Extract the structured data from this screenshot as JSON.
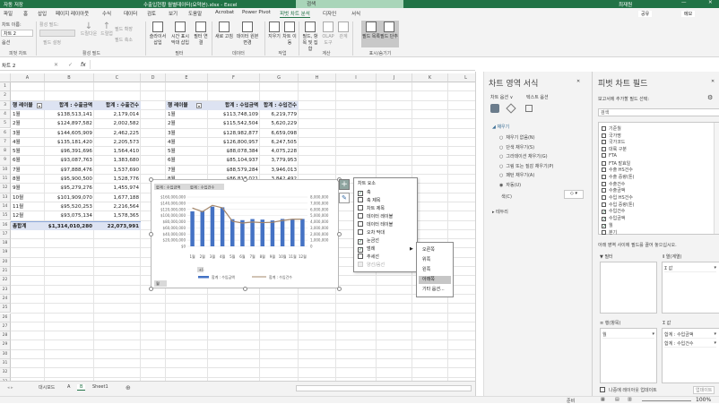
{
  "title_bar": {
    "autosave": "자동 저장",
    "filename": "수출입현황 월별데이터(요약본).xlsx - Excel",
    "search": "검색",
    "user": "최재원"
  },
  "ribbon_tabs": [
    "파일",
    "홈",
    "삽입",
    "페이지 레이아웃",
    "수식",
    "데이터",
    "검토",
    "보기",
    "도움말",
    "Acrobat",
    "Power Pivot",
    "피벗 차트 분석",
    "디자인",
    "서식"
  ],
  "ribbon_right": {
    "share": "공유",
    "memo": "메모"
  },
  "ribbon": {
    "chart_name_label": "차트 이름:",
    "chart_name": "차트 2",
    "options": "옵션",
    "g_pivotchart": "피벗 차트",
    "active_field_label": "활성 필드:",
    "field_settings": "필드 설정",
    "drilldown": "드릴다운",
    "drillup": "드릴업",
    "expand": "필드 확장",
    "collapse": "필드 축소",
    "g_active": "활성 필드",
    "slicer": "슬라이서 삽입",
    "timeline": "시간 표시 막대 삽입",
    "filter_conn": "필터 연결",
    "g_filter": "필터",
    "refresh": "새로 고침",
    "change_source": "데이터 원본 변경",
    "g_data": "데이터",
    "clear": "지우기",
    "move_chart": "차트 이동",
    "g_actions": "작업",
    "fields_items": "필드, 항목 및 집합",
    "olap": "OLAP 도구",
    "relations": "관계",
    "g_calc": "계산",
    "field_list": "필드 목록",
    "field_buttons": "필드 단추",
    "g_show": "표시/숨기기"
  },
  "formula_bar": {
    "name_box": "차트 2",
    "fx": "fx",
    "value": ""
  },
  "columns": [
    "A",
    "B",
    "C",
    "D",
    "E",
    "F",
    "G",
    "H",
    "I",
    "J",
    "K",
    "L",
    "M",
    "N"
  ],
  "left_pivot": {
    "headers": [
      "행 레이블",
      "합계 : 수출금액",
      "합계 : 수출건수"
    ],
    "rows": [
      [
        "1월",
        "$138,513,141",
        "2,179,014"
      ],
      [
        "2월",
        "$124,897,582",
        "2,002,582"
      ],
      [
        "3월",
        "$144,605,909",
        "2,462,225"
      ],
      [
        "4월",
        "$135,181,420",
        "2,205,573"
      ],
      [
        "5월",
        "$96,391,696",
        "1,564,410"
      ],
      [
        "6월",
        "$93,087,763",
        "1,383,680"
      ],
      [
        "7월",
        "$97,888,476",
        "1,537,690"
      ],
      [
        "8월",
        "$95,900,500",
        "1,528,776"
      ],
      [
        "9월",
        "$95,279,276",
        "1,455,974"
      ],
      [
        "10월",
        "$101,909,070",
        "1,677,188"
      ],
      [
        "11월",
        "$95,520,253",
        "2,216,564"
      ],
      [
        "12월",
        "$93,075,134",
        "1,578,365"
      ]
    ],
    "total": [
      "총합계",
      "$1,314,010,280",
      "22,073,991"
    ]
  },
  "right_pivot": {
    "headers": [
      "행 레이블",
      "합계 : 수입금액",
      "합계 : 수입건수"
    ],
    "rows": [
      [
        "1월",
        "$113,748,109",
        "6,219,779"
      ],
      [
        "2월",
        "$115,542,504",
        "5,620,229"
      ],
      [
        "3월",
        "$128,982,877",
        "6,659,098"
      ],
      [
        "4월",
        "$126,800,957",
        "6,247,505"
      ],
      [
        "5월",
        "$88,078,384",
        "4,075,228"
      ],
      [
        "6월",
        "$85,104,937",
        "3,779,953"
      ],
      [
        "7월",
        "$88,579,284",
        "3,946,013"
      ],
      [
        "8월",
        "$86,818,021",
        "3,842,492"
      ]
    ]
  },
  "chart_data": {
    "type": "bar+line",
    "title": "",
    "field_buttons": [
      "합계 : 수입금액",
      "합계 : 수입건수"
    ],
    "categories": [
      "1월",
      "2월",
      "3월",
      "4월",
      "5월",
      "6월",
      "7월",
      "8월",
      "9월",
      "10월",
      "11월",
      "12월"
    ],
    "series": [
      {
        "name": "합계 : 수입금액",
        "type": "bar",
        "axis": "left",
        "color": "#4472c4",
        "values": [
          113748109,
          115542504,
          128982877,
          126800957,
          88078384,
          85104937,
          88579284,
          86818021,
          84000000,
          89000000,
          89000000,
          89000000
        ]
      },
      {
        "name": "합계 : 수입건수",
        "type": "line",
        "axis": "right",
        "color": "#a5876a",
        "values": [
          6219779,
          5620229,
          6659098,
          6247505,
          4075228,
          3779953,
          3946013,
          3842492,
          3900000,
          4200000,
          4400000,
          4400000
        ]
      }
    ],
    "y_left": {
      "range": [
        0,
        160000000
      ],
      "ticks": [
        "$0",
        "$20,000,000",
        "$40,000,000",
        "$60,000,000",
        "$80,000,000",
        "$100,000,000",
        "$120,000,000",
        "$140,000,000",
        "$160,000,000"
      ]
    },
    "y_right": {
      "range": [
        0,
        8000000
      ],
      "ticks": [
        "0",
        "1,000,000",
        "2,000,000",
        "3,000,000",
        "4,000,000",
        "5,000,000",
        "6,000,000",
        "7,000,000",
        "8,000,000"
      ]
    },
    "grid": true,
    "legend": "bottom",
    "axis_field_button": "월"
  },
  "chart_elements": {
    "title": "차트 요소",
    "items": [
      {
        "label": "축",
        "checked": true
      },
      {
        "label": "축 제목",
        "checked": false
      },
      {
        "label": "차트 제목",
        "checked": false
      },
      {
        "label": "데이터 레이블",
        "checked": false
      },
      {
        "label": "데이터 테이블",
        "checked": false
      },
      {
        "label": "오차 막대",
        "checked": false
      },
      {
        "label": "눈금선",
        "checked": true
      },
      {
        "label": "범례",
        "checked": true
      },
      {
        "label": "추세선",
        "checked": false
      },
      {
        "label": "양선/음선",
        "checked": false
      }
    ],
    "legend_submenu": [
      "오른쪽",
      "위쪽",
      "왼쪽",
      "아래쪽",
      "기타 옵션..."
    ],
    "highlighted": "아래쪽"
  },
  "format_pane": {
    "title": "차트 영역 서식",
    "tab_chart": "차트 옵션 ∨",
    "tab_text": "텍스트 옵션",
    "fill_section": "채우기",
    "fill_options": [
      "채우기 없음(N)",
      "단색 채우기(S)",
      "그라데이션 채우기(G)",
      "그림 또는 질감 채우기(P)",
      "패턴 채우기(A)",
      "자동(U)"
    ],
    "selected": "자동(U)",
    "color_label": "색(C)",
    "border_section": "테두리"
  },
  "pivot_pane": {
    "title": "피벗 차트 필드",
    "subtitle": "보고서에 추가할 필드 선택:",
    "search_placeholder": "검색",
    "fields": [
      {
        "label": "기준월",
        "checked": false
      },
      {
        "label": "국가명",
        "checked": false
      },
      {
        "label": "국가코드",
        "checked": false
      },
      {
        "label": "대륙 구분",
        "checked": false
      },
      {
        "label": "FTA",
        "checked": false
      },
      {
        "label": "FTA 발효일",
        "checked": false
      },
      {
        "label": "수출 HS건수",
        "checked": false
      },
      {
        "label": "수출 중량(톤)",
        "checked": false
      },
      {
        "label": "수출건수",
        "checked": false
      },
      {
        "label": "수출금액",
        "checked": false
      },
      {
        "label": "수입 HS건수",
        "checked": false
      },
      {
        "label": "수입 중량(톤)",
        "checked": false
      },
      {
        "label": "수입건수",
        "checked": true
      },
      {
        "label": "수입금액",
        "checked": true
      },
      {
        "label": "월",
        "checked": true
      },
      {
        "label": "분기",
        "checked": false
      }
    ],
    "drag_hint": "아래 영역 사이에 필드를 끌어 놓으십시오.",
    "filter_label": "필터",
    "columns_label": "열(계열)",
    "rows_label": "행(항목)",
    "values_label": "값",
    "columns_items": [
      "Σ 값"
    ],
    "rows_items": [
      "월"
    ],
    "values_items": [
      "합계 : 수입금액",
      "합계 : 수입건수"
    ],
    "defer_label": "나중에 레이아웃 업데이트",
    "update_button": "업데이트"
  },
  "sheet_tabs": [
    "대시보드",
    "A",
    "B",
    "Sheet1"
  ],
  "active_sheet": "B",
  "status": {
    "ready": "준비",
    "zoom": "100%"
  }
}
